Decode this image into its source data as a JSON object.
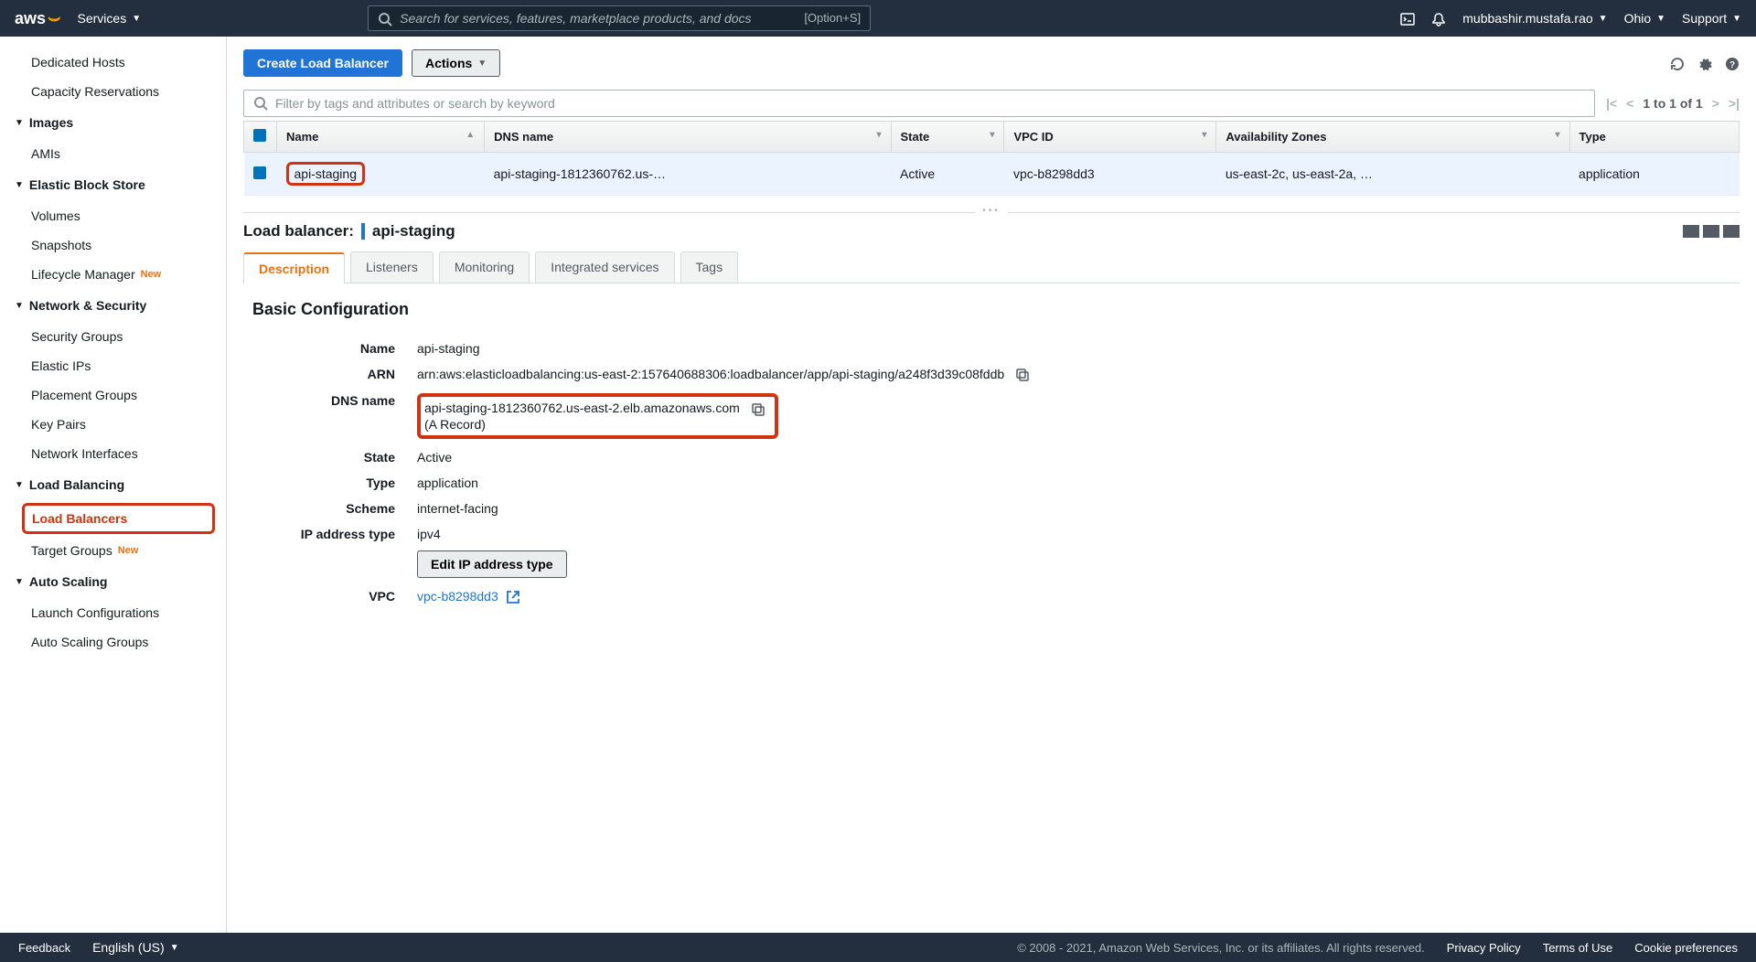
{
  "header": {
    "services": "Services",
    "search_placeholder": "Search for services, features, marketplace products, and docs",
    "shortcut": "[Option+S]",
    "username": "mubbashir.mustafa.rao",
    "region": "Ohio",
    "support": "Support"
  },
  "sidebar": {
    "dedicated_hosts": "Dedicated Hosts",
    "capacity_reservations": "Capacity Reservations",
    "images": "Images",
    "amis": "AMIs",
    "ebs": "Elastic Block Store",
    "volumes": "Volumes",
    "snapshots": "Snapshots",
    "lifecycle_manager": "Lifecycle Manager",
    "network_security": "Network & Security",
    "security_groups": "Security Groups",
    "elastic_ips": "Elastic IPs",
    "placement_groups": "Placement Groups",
    "key_pairs": "Key Pairs",
    "network_interfaces": "Network Interfaces",
    "load_balancing": "Load Balancing",
    "load_balancers": "Load Balancers",
    "target_groups": "Target Groups",
    "auto_scaling": "Auto Scaling",
    "launch_configurations": "Launch Configurations",
    "auto_scaling_groups": "Auto Scaling Groups",
    "new": "New"
  },
  "actions": {
    "create": "Create Load Balancer",
    "actions": "Actions"
  },
  "filter": {
    "placeholder": "Filter by tags and attributes or search by keyword"
  },
  "pagination": {
    "text": "1 to 1 of 1"
  },
  "table": {
    "headers": {
      "name": "Name",
      "dns": "DNS name",
      "state": "State",
      "vpc": "VPC ID",
      "az": "Availability Zones",
      "type": "Type"
    },
    "row": {
      "name": "api-staging",
      "dns": "api-staging-1812360762.us-…",
      "state": "Active",
      "vpc": "vpc-b8298dd3",
      "az": "us-east-2c, us-east-2a, …",
      "type": "application"
    }
  },
  "detail": {
    "header_label": "Load balancer:",
    "header_name": "api-staging",
    "tabs": {
      "description": "Description",
      "listeners": "Listeners",
      "monitoring": "Monitoring",
      "integrated": "Integrated services",
      "tags": "Tags"
    },
    "section_title": "Basic Configuration",
    "labels": {
      "name": "Name",
      "arn": "ARN",
      "dns": "DNS name",
      "state": "State",
      "type": "Type",
      "scheme": "Scheme",
      "ip_type": "IP address type",
      "vpc": "VPC"
    },
    "values": {
      "name": "api-staging",
      "arn": "arn:aws:elasticloadbalancing:us-east-2:157640688306:loadbalancer/app/api-staging/a248f3d39c08fddb",
      "dns": "api-staging-1812360762.us-east-2.elb.amazonaws.com",
      "dns_record": "(A Record)",
      "state": "Active",
      "type": "application",
      "scheme": "internet-facing",
      "ip_type": "ipv4",
      "edit_ip": "Edit IP address type",
      "vpc": "vpc-b8298dd3"
    }
  },
  "footer": {
    "feedback": "Feedback",
    "language": "English (US)",
    "copyright": "© 2008 - 2021, Amazon Web Services, Inc. or its affiliates. All rights reserved.",
    "privacy": "Privacy Policy",
    "terms": "Terms of Use",
    "cookies": "Cookie preferences"
  }
}
